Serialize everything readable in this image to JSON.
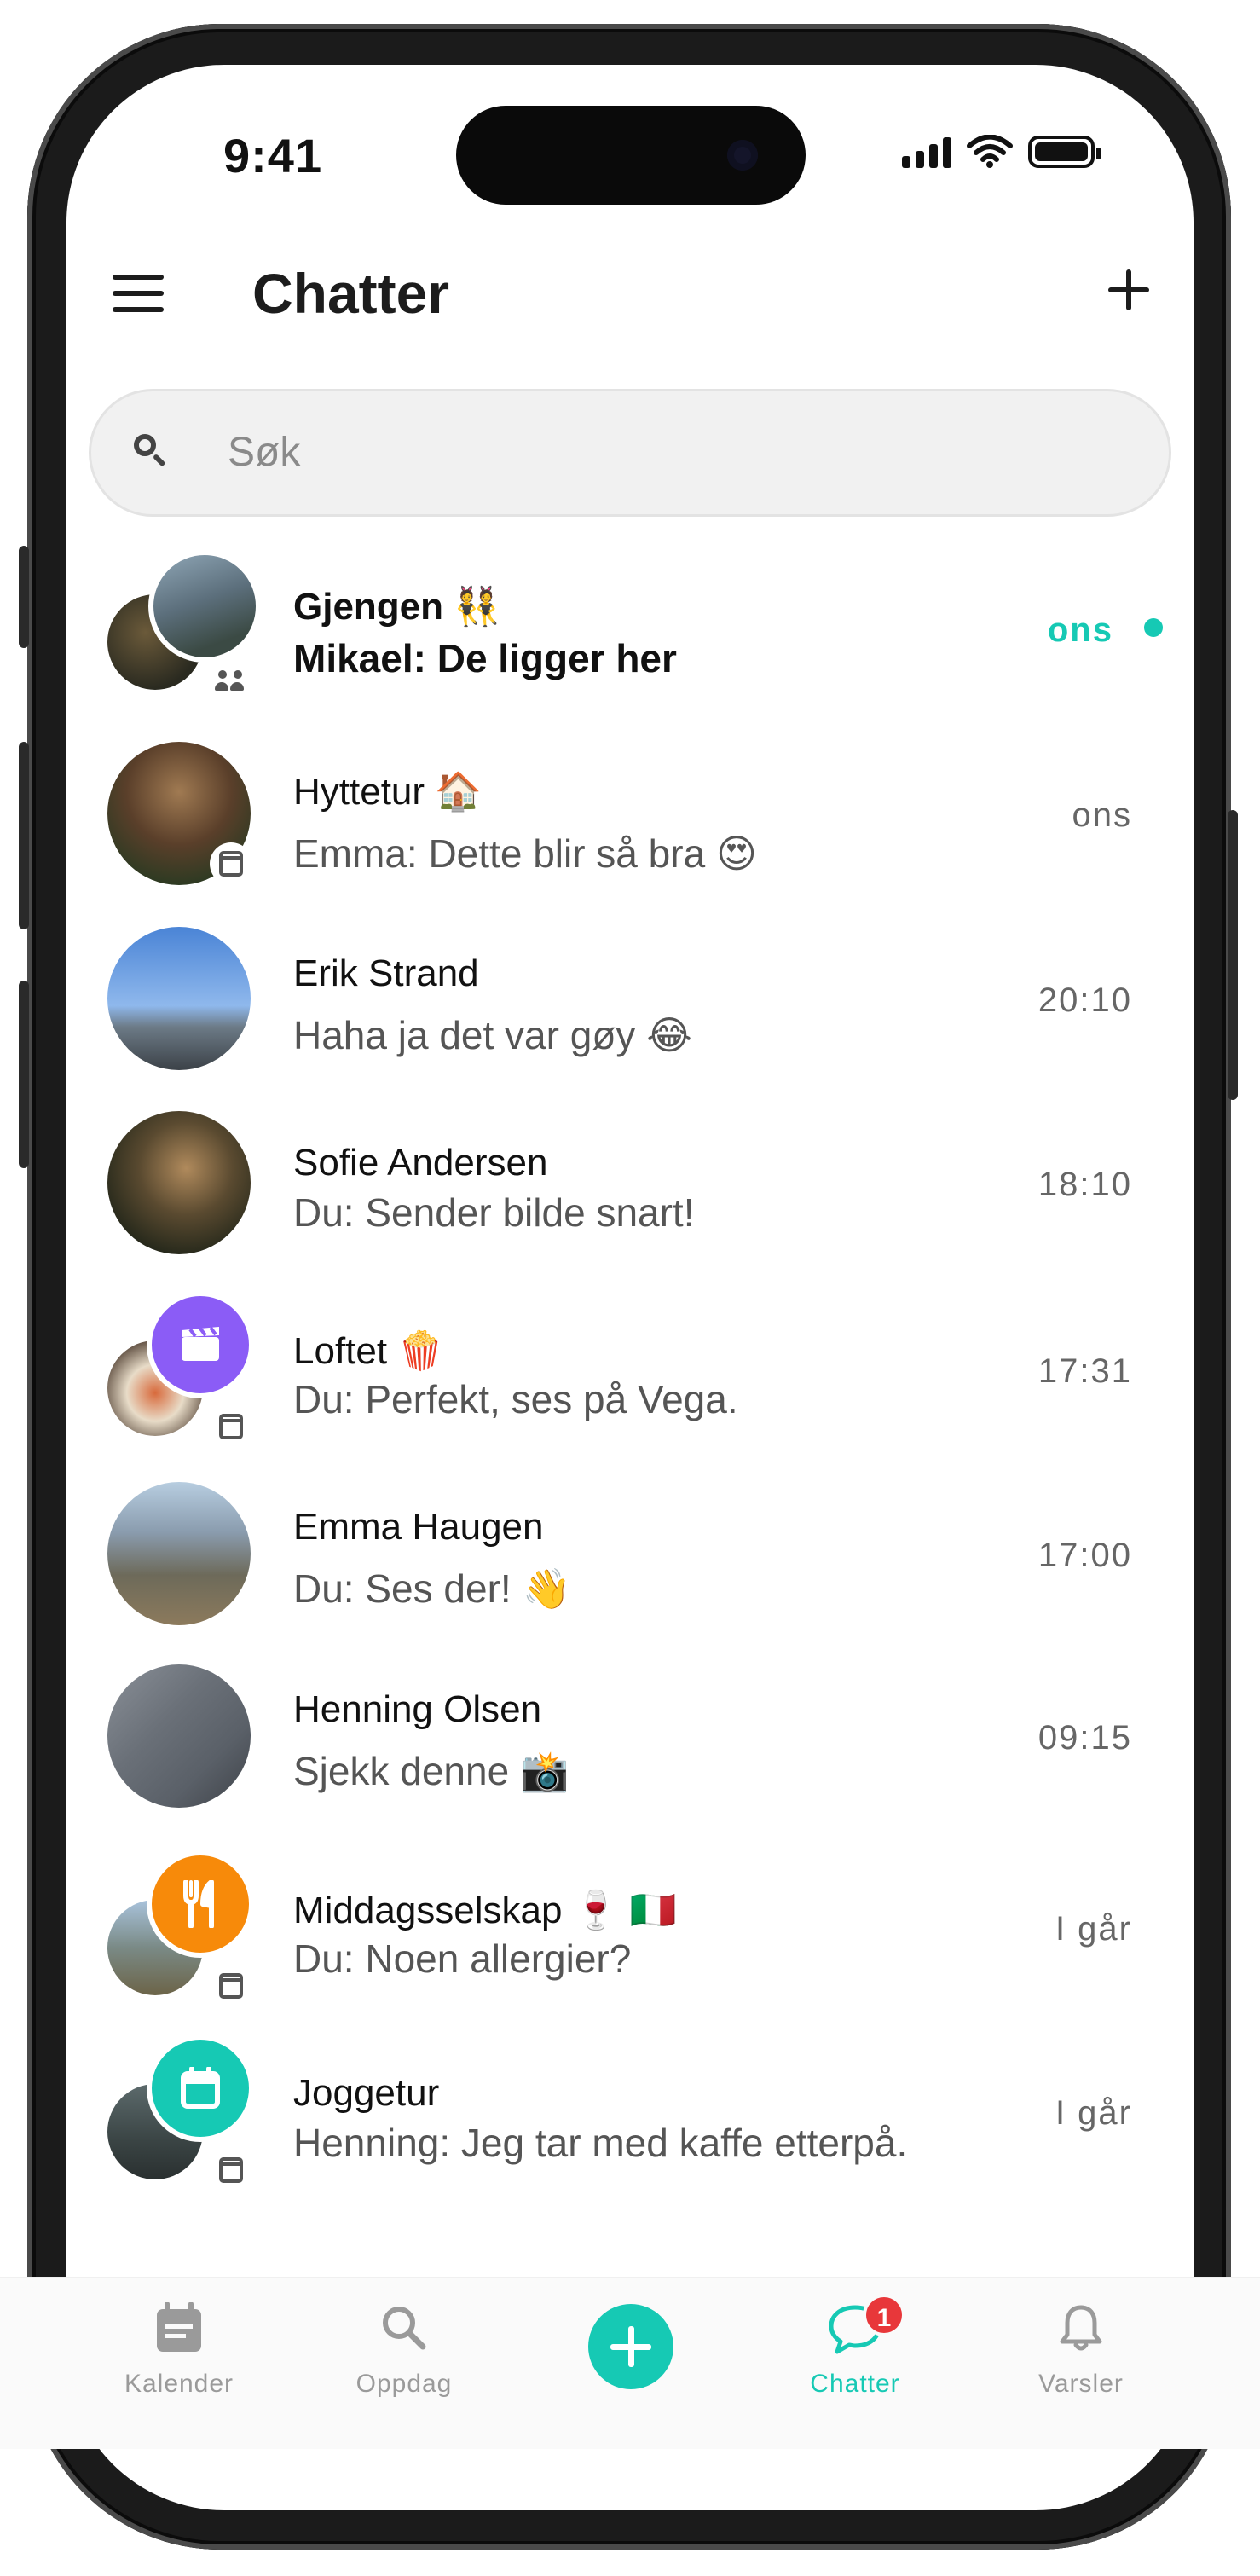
{
  "status_bar": {
    "time": "9:41"
  },
  "header": {
    "title": "Chatter"
  },
  "search": {
    "placeholder": "Søk"
  },
  "chats": [
    {
      "name": "Gjengen 👯",
      "message": "Mikael: De ligger her",
      "time": "ons",
      "unread": true,
      "type": "group"
    },
    {
      "name": "Hyttetur 🏠",
      "message": "Emma: Dette blir så bra 😍",
      "time": "ons",
      "unread": false,
      "type": "event"
    },
    {
      "name": "Erik Strand",
      "message": "Haha ja det var gøy 😂",
      "time": "20:10",
      "unread": false,
      "type": "person"
    },
    {
      "name": "Sofie Andersen",
      "message": "Du: Sender bilde snart!",
      "time": "18:10",
      "unread": false,
      "type": "person"
    },
    {
      "name": "Loftet 🍿",
      "message": "Du: Perfekt, ses på Vega.",
      "time": "17:31",
      "unread": false,
      "type": "event",
      "icon": "clapperboard-icon",
      "icon_color": "#8b5cf6"
    },
    {
      "name": "Emma Haugen",
      "message": "Du: Ses der! 👋",
      "time": "17:00",
      "unread": false,
      "type": "person"
    },
    {
      "name": "Henning Olsen",
      "message": "Sjekk denne 📸",
      "time": "09:15",
      "unread": false,
      "type": "person"
    },
    {
      "name": "Middagsselskap 🍷 🇮🇹",
      "message": "Du: Noen allergier?",
      "time": "I går",
      "unread": false,
      "type": "event",
      "icon": "fork-knife-icon",
      "icon_color": "#f78a0a"
    },
    {
      "name": "Joggetur",
      "message": "Henning: Jeg tar med kaffe etterpå.",
      "time": "I går",
      "unread": false,
      "type": "event",
      "icon": "calendar-icon",
      "icon_color": "#16c9b4"
    }
  ],
  "tabbar": {
    "items": [
      {
        "label": "Kalender",
        "icon": "calendar-icon"
      },
      {
        "label": "Oppdag",
        "icon": "search-icon"
      },
      {
        "label": "Chatter",
        "icon": "chat-icon",
        "active": true,
        "badge": "1"
      },
      {
        "label": "Varsler",
        "icon": "bell-icon"
      }
    ]
  },
  "colors": {
    "accent": "#16c9b4",
    "badge": "#e8373a",
    "text": "#111111",
    "muted": "#555555"
  }
}
